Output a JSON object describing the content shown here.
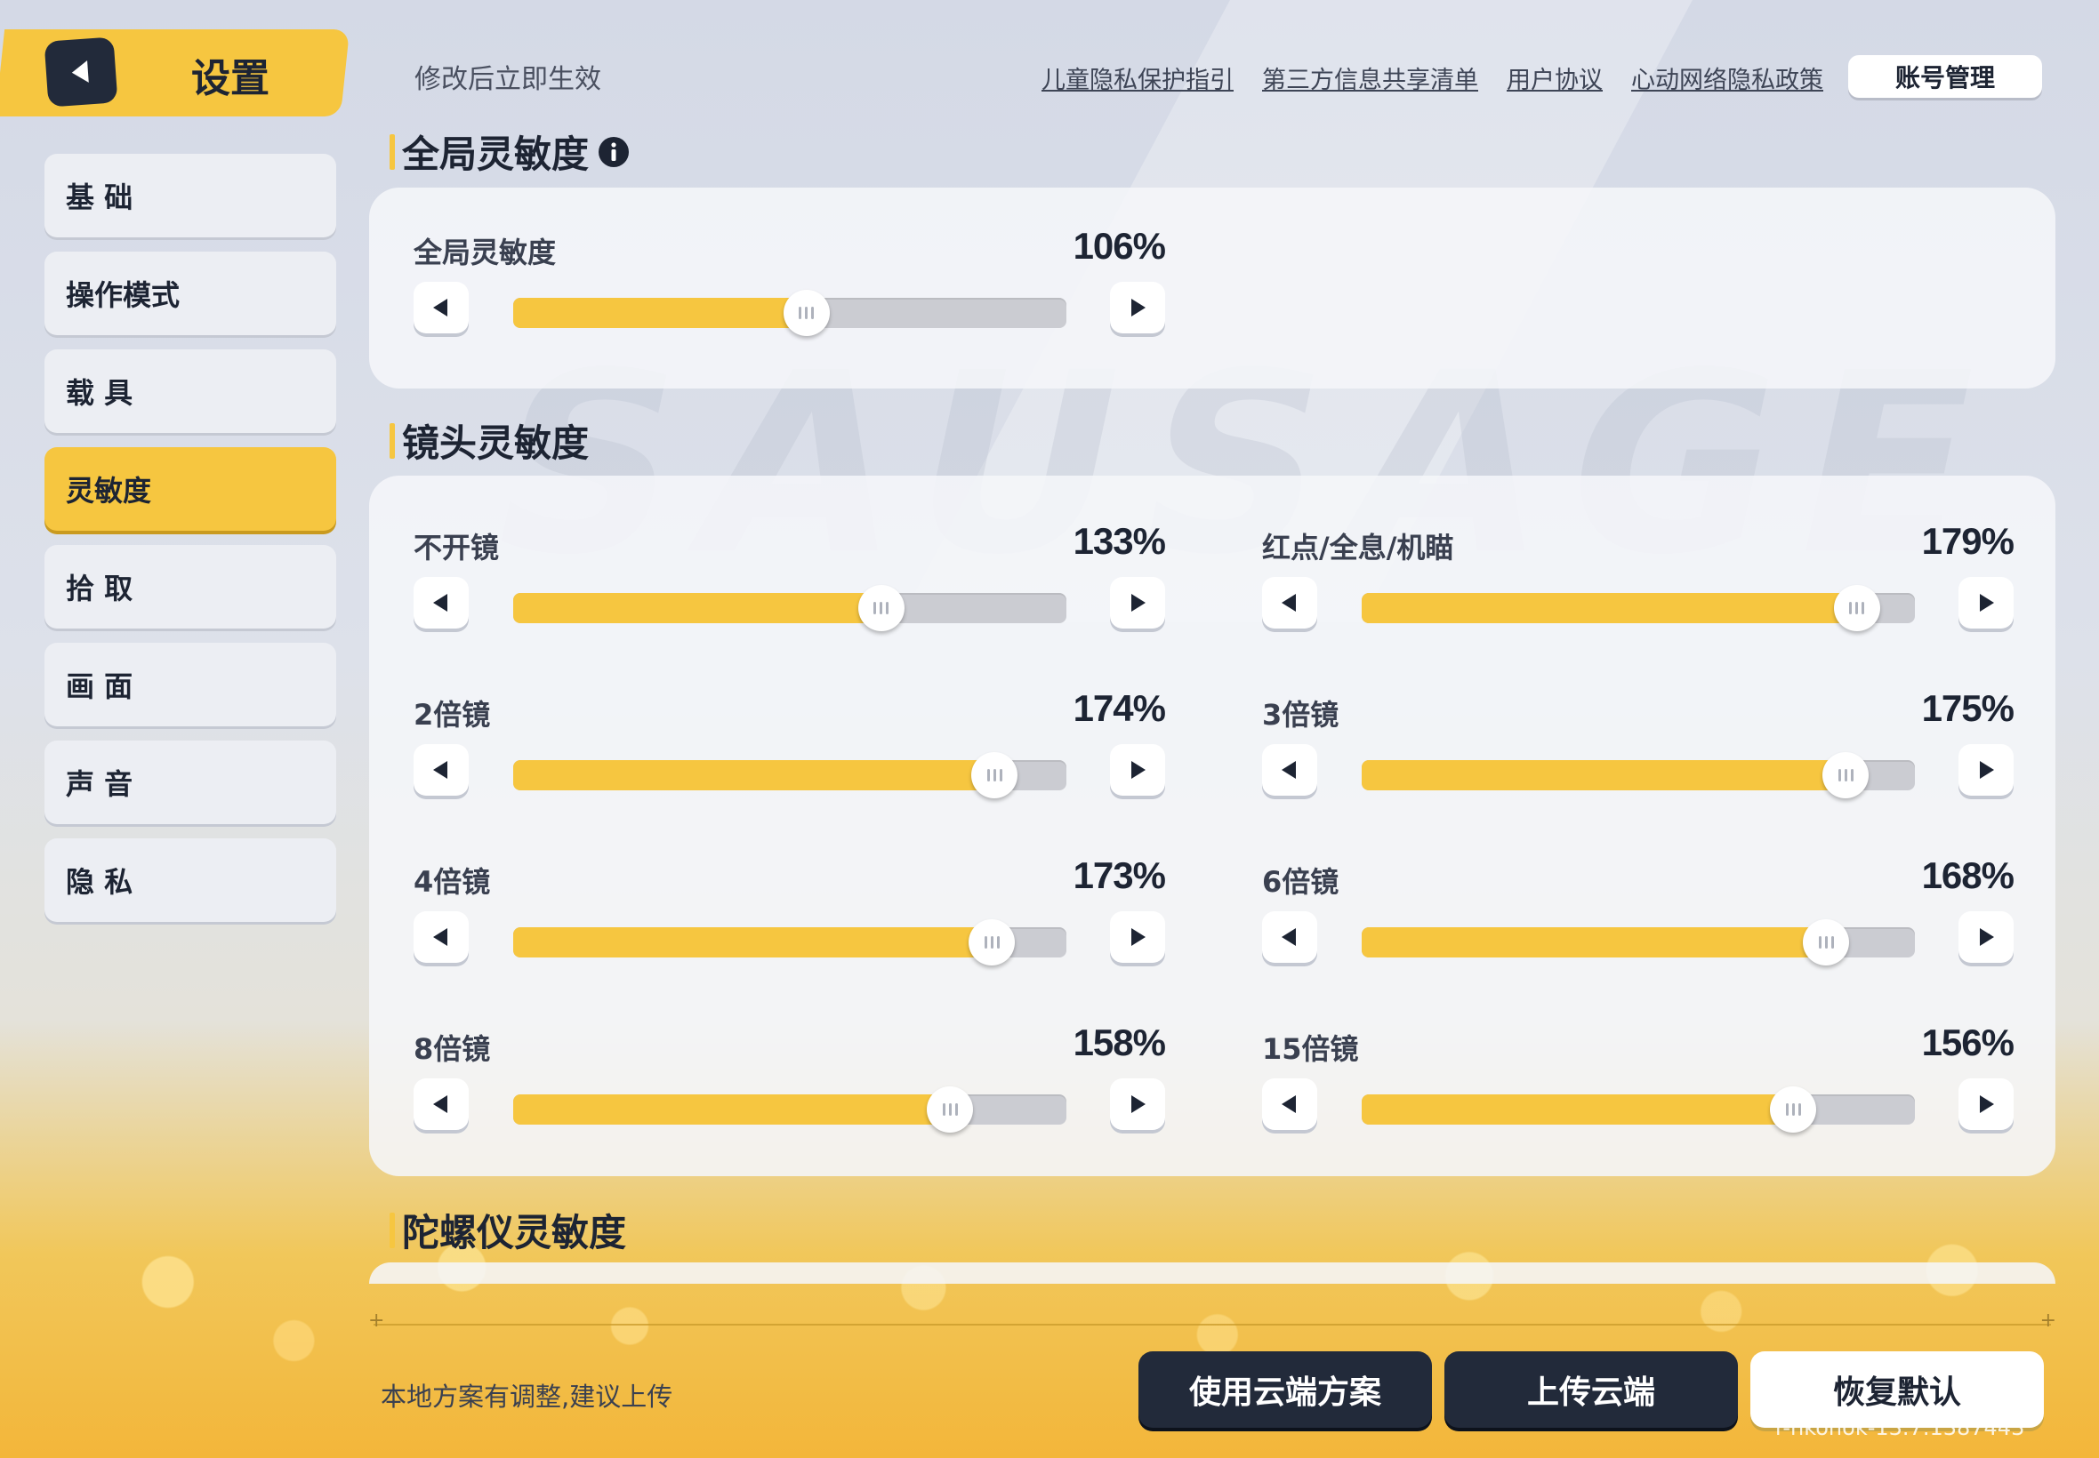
{
  "header": {
    "title": "设置",
    "effect_note": "修改后立即生效",
    "links": [
      "儿童隐私保护指引",
      "第三方信息共享清单",
      "用户协议",
      "心动网络隐私政策"
    ],
    "account_button": "账号管理"
  },
  "sidebar": {
    "items": [
      {
        "label": "基 础",
        "active": false
      },
      {
        "label": "操作模式",
        "active": false
      },
      {
        "label": "载 具",
        "active": false
      },
      {
        "label": "灵敏度",
        "active": true
      },
      {
        "label": "拾 取",
        "active": false
      },
      {
        "label": "画 面",
        "active": false
      },
      {
        "label": "声 音",
        "active": false
      },
      {
        "label": "隐 私",
        "active": false
      }
    ]
  },
  "sections": {
    "global": {
      "title": "全局灵敏度",
      "sliders": [
        {
          "label": "全局灵敏度",
          "value": "106%",
          "level": 0.53
        }
      ]
    },
    "scope": {
      "title": "镜头灵敏度",
      "sliders": [
        {
          "label": "不开镜",
          "value": "133%",
          "level": 0.665
        },
        {
          "label": "红点/全息/机瞄",
          "value": "179%",
          "level": 0.895
        },
        {
          "label": "2倍镜",
          "value": "174%",
          "level": 0.87
        },
        {
          "label": "3倍镜",
          "value": "175%",
          "level": 0.875
        },
        {
          "label": "4倍镜",
          "value": "173%",
          "level": 0.865
        },
        {
          "label": "6倍镜",
          "value": "168%",
          "level": 0.84
        },
        {
          "label": "8倍镜",
          "value": "158%",
          "level": 0.79
        },
        {
          "label": "15倍镜",
          "value": "156%",
          "level": 0.78
        }
      ]
    },
    "gyro": {
      "title": "陀螺仪灵敏度"
    }
  },
  "footer": {
    "note": "本地方案有调整,建议上传",
    "use_cloud": "使用云端方案",
    "upload_cloud": "上传云端",
    "restore_default": "恢复默认",
    "version": "r-nkonok-13.7.1387443"
  },
  "colors": {
    "accent": "#f6c640",
    "dark": "#222a3a",
    "track": "#cbccd2"
  }
}
